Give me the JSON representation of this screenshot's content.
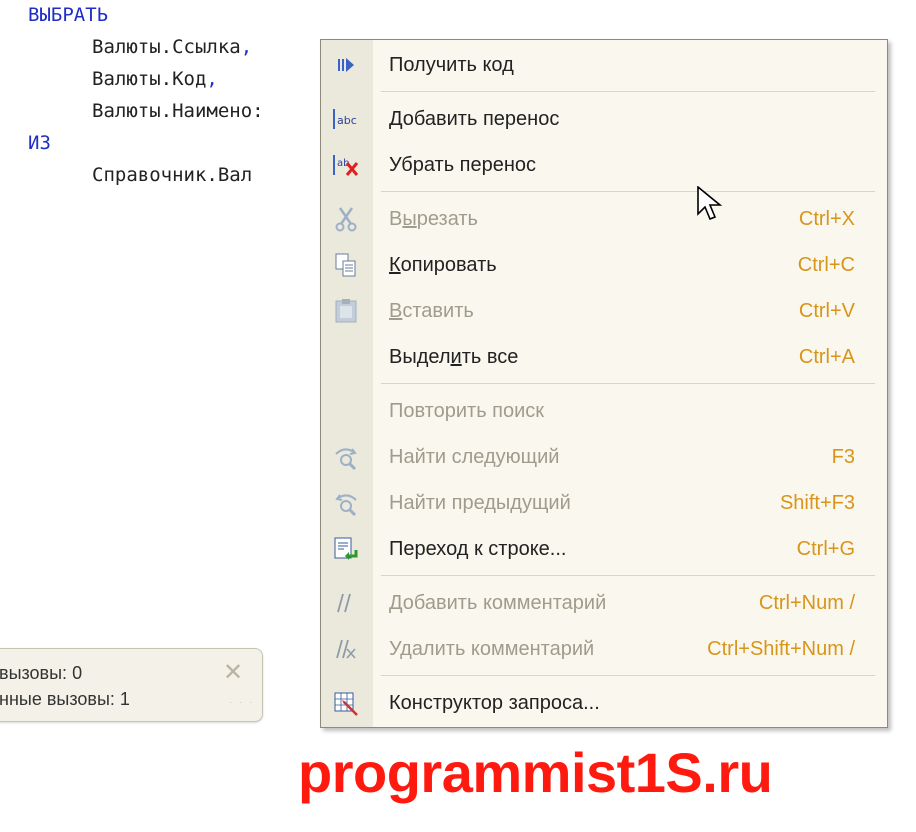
{
  "editor": {
    "lines": [
      {
        "text": "ВЫБРАТЬ"
      },
      {
        "text": "Валюты.Ссылка",
        "punct": ","
      },
      {
        "text": "Валюты.Код",
        "punct": ","
      },
      {
        "text": "Валюты.Наимено:"
      },
      {
        "text": "ИЗ"
      },
      {
        "text": "Справочник.Вал"
      }
    ]
  },
  "status_popup": {
    "line1_label": "вызовы:",
    "line1_value": "0",
    "line2_label": "нные вызовы:",
    "line2_value": "1",
    "close_icon": "close-icon"
  },
  "menu": {
    "items": [
      {
        "label": "Получить код",
        "shortcut": "",
        "icon": "get-code-icon",
        "enabled": true
      },
      {
        "label": "Добавить перенос",
        "shortcut": "",
        "icon": "add-wrap-icon",
        "enabled": true
      },
      {
        "label": "Убрать перенос",
        "shortcut": "",
        "icon": "remove-wrap-icon",
        "enabled": true
      },
      {
        "label_pre": "В",
        "label_u": "ы",
        "label_post": "резать",
        "shortcut": "Ctrl+X",
        "icon": "scissors-icon",
        "enabled": false
      },
      {
        "label_pre": "",
        "label_u": "К",
        "label_post": "опировать",
        "shortcut": "Ctrl+C",
        "icon": "copy-icon",
        "enabled": true
      },
      {
        "label_pre": "",
        "label_u": "В",
        "label_post": "ставить",
        "shortcut": "Ctrl+V",
        "icon": "paste-icon",
        "enabled": false
      },
      {
        "label_pre": "Выдел",
        "label_u": "и",
        "label_post": "ть все",
        "shortcut": "Ctrl+A",
        "icon": "",
        "enabled": true
      },
      {
        "label": "Повторить поиск",
        "shortcut": "",
        "icon": "",
        "enabled": false
      },
      {
        "label": "Найти следующий",
        "shortcut": "F3",
        "icon": "find-next-icon",
        "enabled": false
      },
      {
        "label": "Найти предыдущий",
        "shortcut": "Shift+F3",
        "icon": "find-previous-icon",
        "enabled": false
      },
      {
        "label": "Переход к строке...",
        "shortcut": "Ctrl+G",
        "icon": "goto-line-icon",
        "enabled": true
      },
      {
        "label": "Добавить комментарий",
        "shortcut": "Ctrl+Num /",
        "icon": "add-comment-icon",
        "enabled": false
      },
      {
        "label": "Удалить комментарий",
        "shortcut": "Ctrl+Shift+Num /",
        "icon": "remove-comment-icon",
        "enabled": false
      },
      {
        "label": "Конструктор запроса...",
        "shortcut": "",
        "icon": "query-builder-icon",
        "enabled": true
      }
    ]
  },
  "watermark": "programmist1S.ru",
  "colors": {
    "keyword": "#1f2ec8",
    "shortcut": "#d9941a",
    "disabled": "#a09c8c",
    "watermark": "#ff1a10"
  }
}
